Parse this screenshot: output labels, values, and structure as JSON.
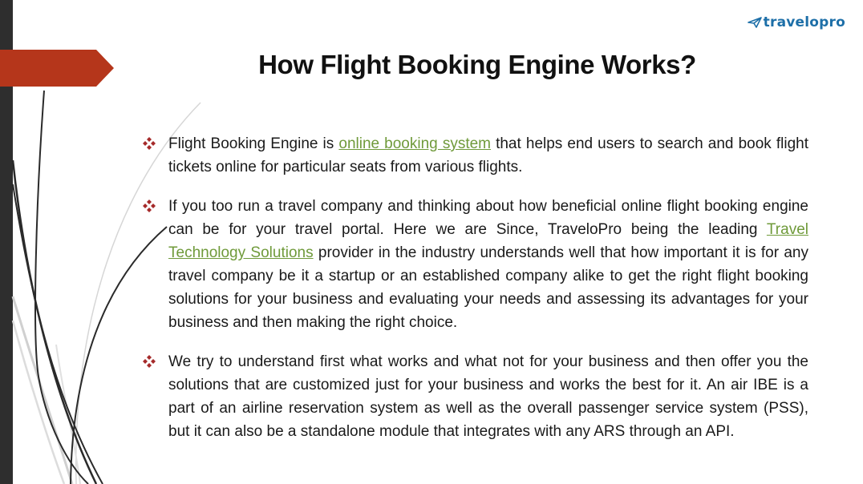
{
  "slide": {
    "logo": {
      "text": "travelopro",
      "icon": "paper-plane-icon"
    },
    "title": "How Flight Booking Engine Works?",
    "colors": {
      "accent_banner": "#b5361b",
      "left_bar": "#2e2e2e",
      "bullet": "#a52a2a",
      "link": "#6f9a3a",
      "logo": "#1d6fa8"
    },
    "bullets": [
      {
        "before": "Flight Booking Engine is ",
        "link": "online booking system",
        "after": " that helps end users to search and book flight tickets online for particular seats from various flights."
      },
      {
        "before": "If you too run a travel company and thinking about how beneficial online flight booking engine can be for your travel portal. Here we are Since, TraveloPro being the leading ",
        "link": "Travel Technology Solutions",
        "after": " provider in the industry understands well that how important it is for any travel company be it a startup or an established company alike to get the right flight booking solutions for your business and evaluating your needs and assessing its advantages for your business and then making the right choice."
      },
      {
        "before": "We try to understand first what works and what not for your business and then offer you the solutions that are customized just for your business and works the best for it. An air IBE is a part of an airline reservation system as well as the overall passenger service system (PSS), but it can also be a standalone module that integrates with any ARS through an API.",
        "link": "",
        "after": ""
      }
    ]
  }
}
